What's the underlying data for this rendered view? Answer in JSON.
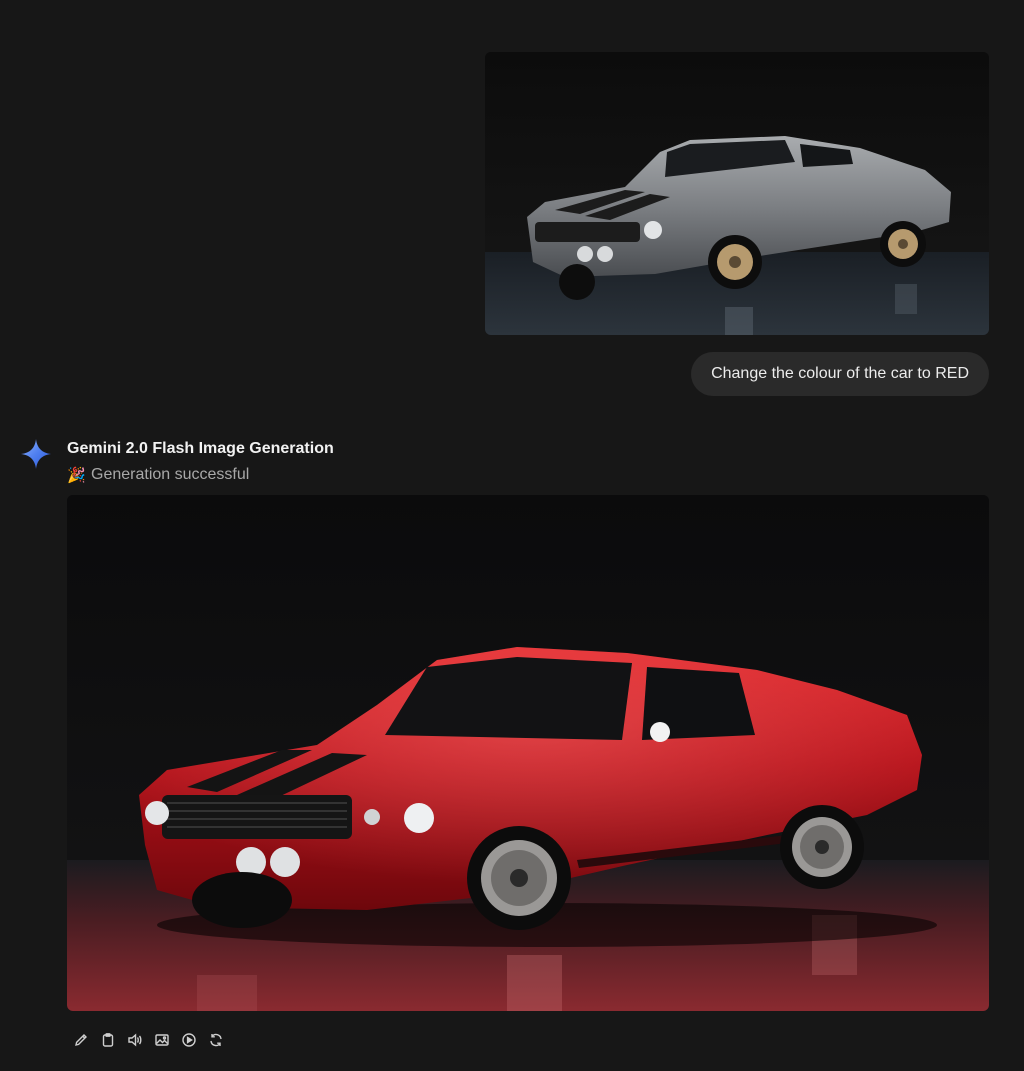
{
  "user_message": {
    "image_alt": "Silver Shelby Mustang GT500 with black stripes",
    "prompt": "Change the colour of the car to RED"
  },
  "assistant": {
    "avatar_icon": "gemini-sparkle-icon",
    "model_name": "Gemini 2.0 Flash Image Generation",
    "status_emoji": "🎉",
    "status_text": "Generation successful",
    "image_alt": "Red Shelby Mustang GT500 with black stripes",
    "actions": [
      {
        "name": "edit",
        "icon": "pencil-icon"
      },
      {
        "name": "copy",
        "icon": "clipboard-icon"
      },
      {
        "name": "read-aloud",
        "icon": "speaker-icon"
      },
      {
        "name": "image",
        "icon": "image-icon"
      },
      {
        "name": "play",
        "icon": "play-circle-icon"
      },
      {
        "name": "regenerate",
        "icon": "refresh-icon"
      }
    ]
  },
  "colors": {
    "background": "#171717",
    "bubble": "#2a2a2a",
    "car_original": "#8a8d90",
    "car_generated": "#c8141a",
    "floor_generated": "#7a1a1f"
  }
}
